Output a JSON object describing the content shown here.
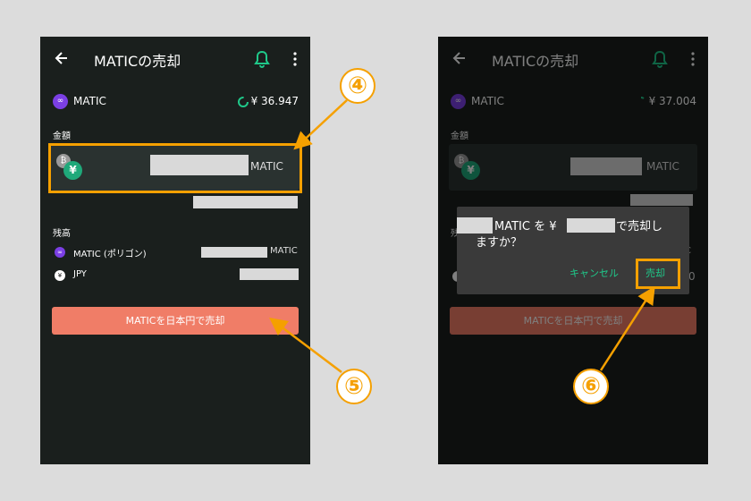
{
  "left": {
    "title": "MATICの売却",
    "coin": "MATIC",
    "rate": "¥ 36.947",
    "amount_label": "金額",
    "amount_unit": "MATIC",
    "balance_label": "残高",
    "balances": [
      {
        "name": "MATIC (ポリゴン)",
        "unit": "MATIC"
      },
      {
        "name": "JPY",
        "unit": ""
      }
    ],
    "sell_button": "MATICを日本円で売却"
  },
  "right": {
    "title": "MATICの売却",
    "coin": "MATIC",
    "rate": "¥ 37.004",
    "amount_label": "金額",
    "amount_unit": "MATIC",
    "balance_label_partial": "残",
    "balance_unit_partial": "C",
    "balance_value_partial": "0",
    "sell_button": "MATICを日本円で売却",
    "dialog": {
      "line1_a": "MATIC を ¥",
      "line1_b": "で売却し",
      "line2": "ますか？",
      "cancel": "キャンセル",
      "confirm": "売却"
    }
  },
  "steps": {
    "four": "④",
    "five": "⑤",
    "six": "⑥"
  },
  "icons": {
    "coin": "polygon-icon",
    "btc": "bitcoin-icon",
    "yen": "yen-icon"
  },
  "colors": {
    "accent": "#f5a000",
    "sell": "#f07d67",
    "green": "#1fc98a"
  }
}
